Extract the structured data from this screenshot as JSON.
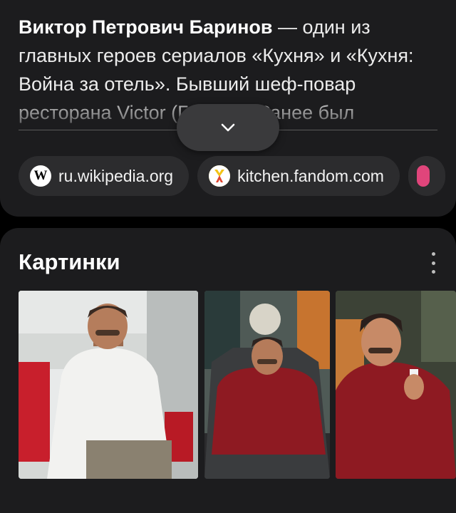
{
  "snippet": {
    "name_bold": "Виктор Петрович Баринов",
    "text": " — один из главных героев сериалов «Кухня» и «Кухня: Война за отель». Бывший шеф-повар ресторана Victor (Г. Б. ..н). Ранее был"
  },
  "sources": [
    {
      "label": "ru.wikipedia.org",
      "icon": "wikipedia-icon"
    },
    {
      "label": "kitchen.fandom.com",
      "icon": "fandom-icon"
    }
  ],
  "images_section": {
    "title": "Картинки",
    "more_icon": "more-vertical-icon"
  },
  "colors": {
    "background": "#000000",
    "card": "#1c1c1e",
    "chip": "#2c2c2e",
    "chef_red": "#8e1a22"
  }
}
